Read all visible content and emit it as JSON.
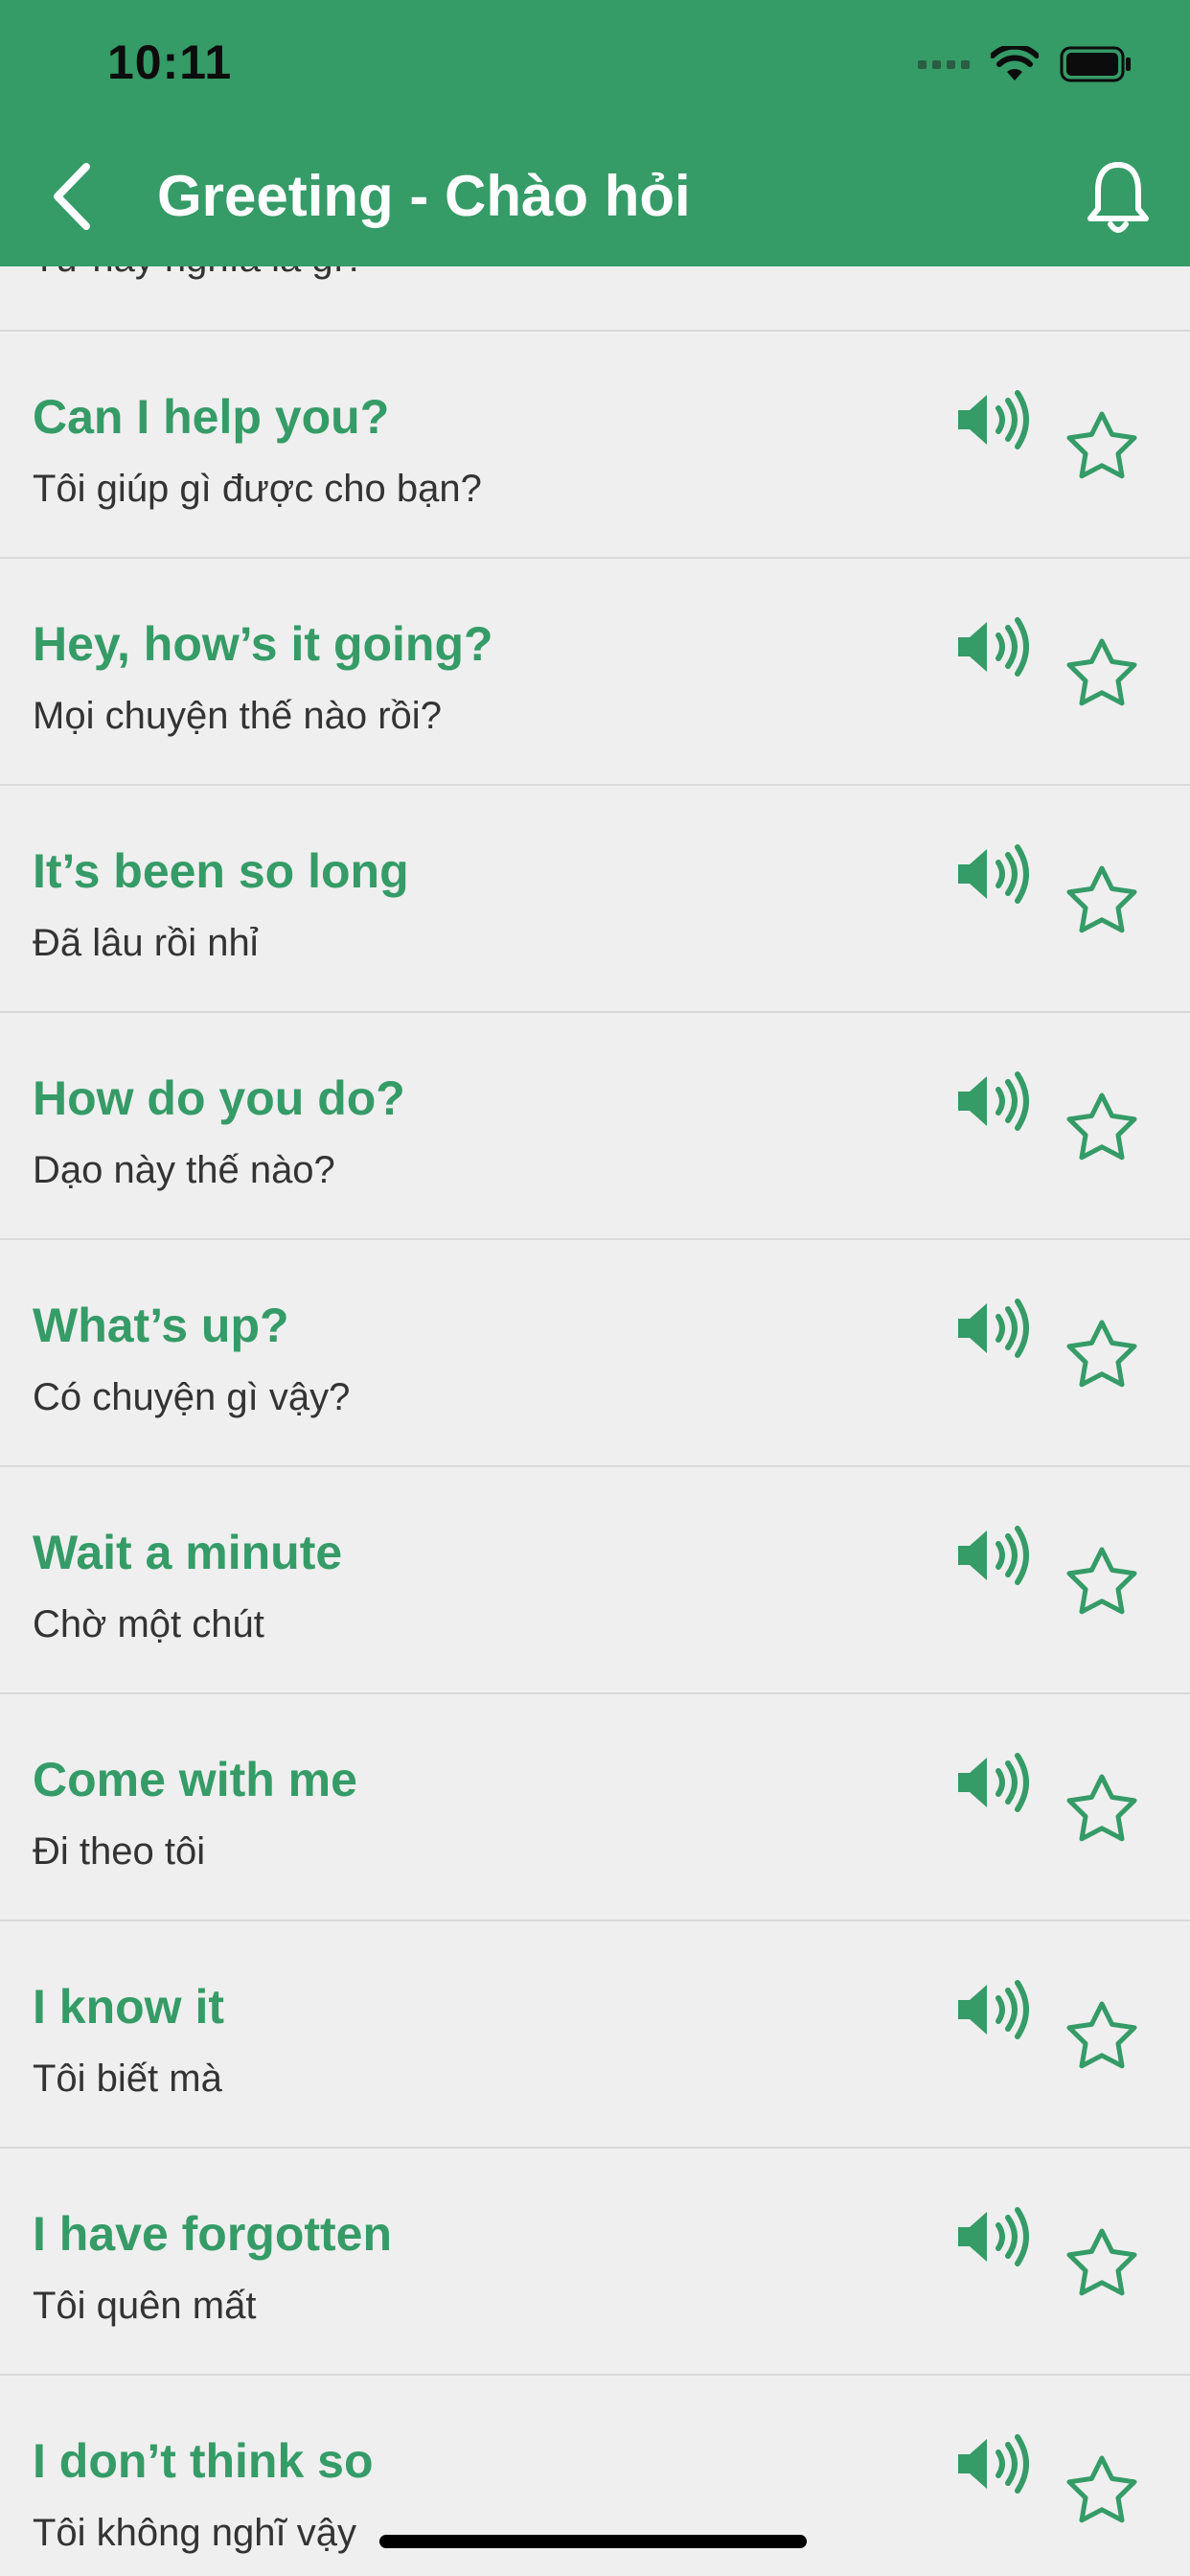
{
  "status_bar": {
    "time": "10:11"
  },
  "header": {
    "title": "Greeting - Chào hỏi",
    "back_icon": "chevron-left-icon",
    "bell_icon": "bell-icon"
  },
  "colors": {
    "accent": "#359b67",
    "background": "#efefef",
    "divider": "#d9d9d9"
  },
  "partial_item": {
    "vi": "Từ này nghĩa là gì?"
  },
  "items": [
    {
      "en": "Can I help you?",
      "vi": "Tôi giúp gì được cho bạn?"
    },
    {
      "en": "Hey, how’s it going?",
      "vi": "Mọi chuyện thế nào rồi?"
    },
    {
      "en": "It’s been so long",
      "vi": "Đã lâu rồi nhỉ"
    },
    {
      "en": "How do you do?",
      "vi": "Dạo này thế nào?"
    },
    {
      "en": "What’s up?",
      "vi": "Có chuyện gì vậy?"
    },
    {
      "en": "Wait a minute",
      "vi": "Chờ một chút"
    },
    {
      "en": "Come with me",
      "vi": "Đi theo tôi"
    },
    {
      "en": "I know it",
      "vi": "Tôi biết mà"
    },
    {
      "en": "I have forgotten",
      "vi": "Tôi quên mất"
    },
    {
      "en": "I don’t think so",
      "vi": "Tôi không nghĩ vậy"
    }
  ]
}
